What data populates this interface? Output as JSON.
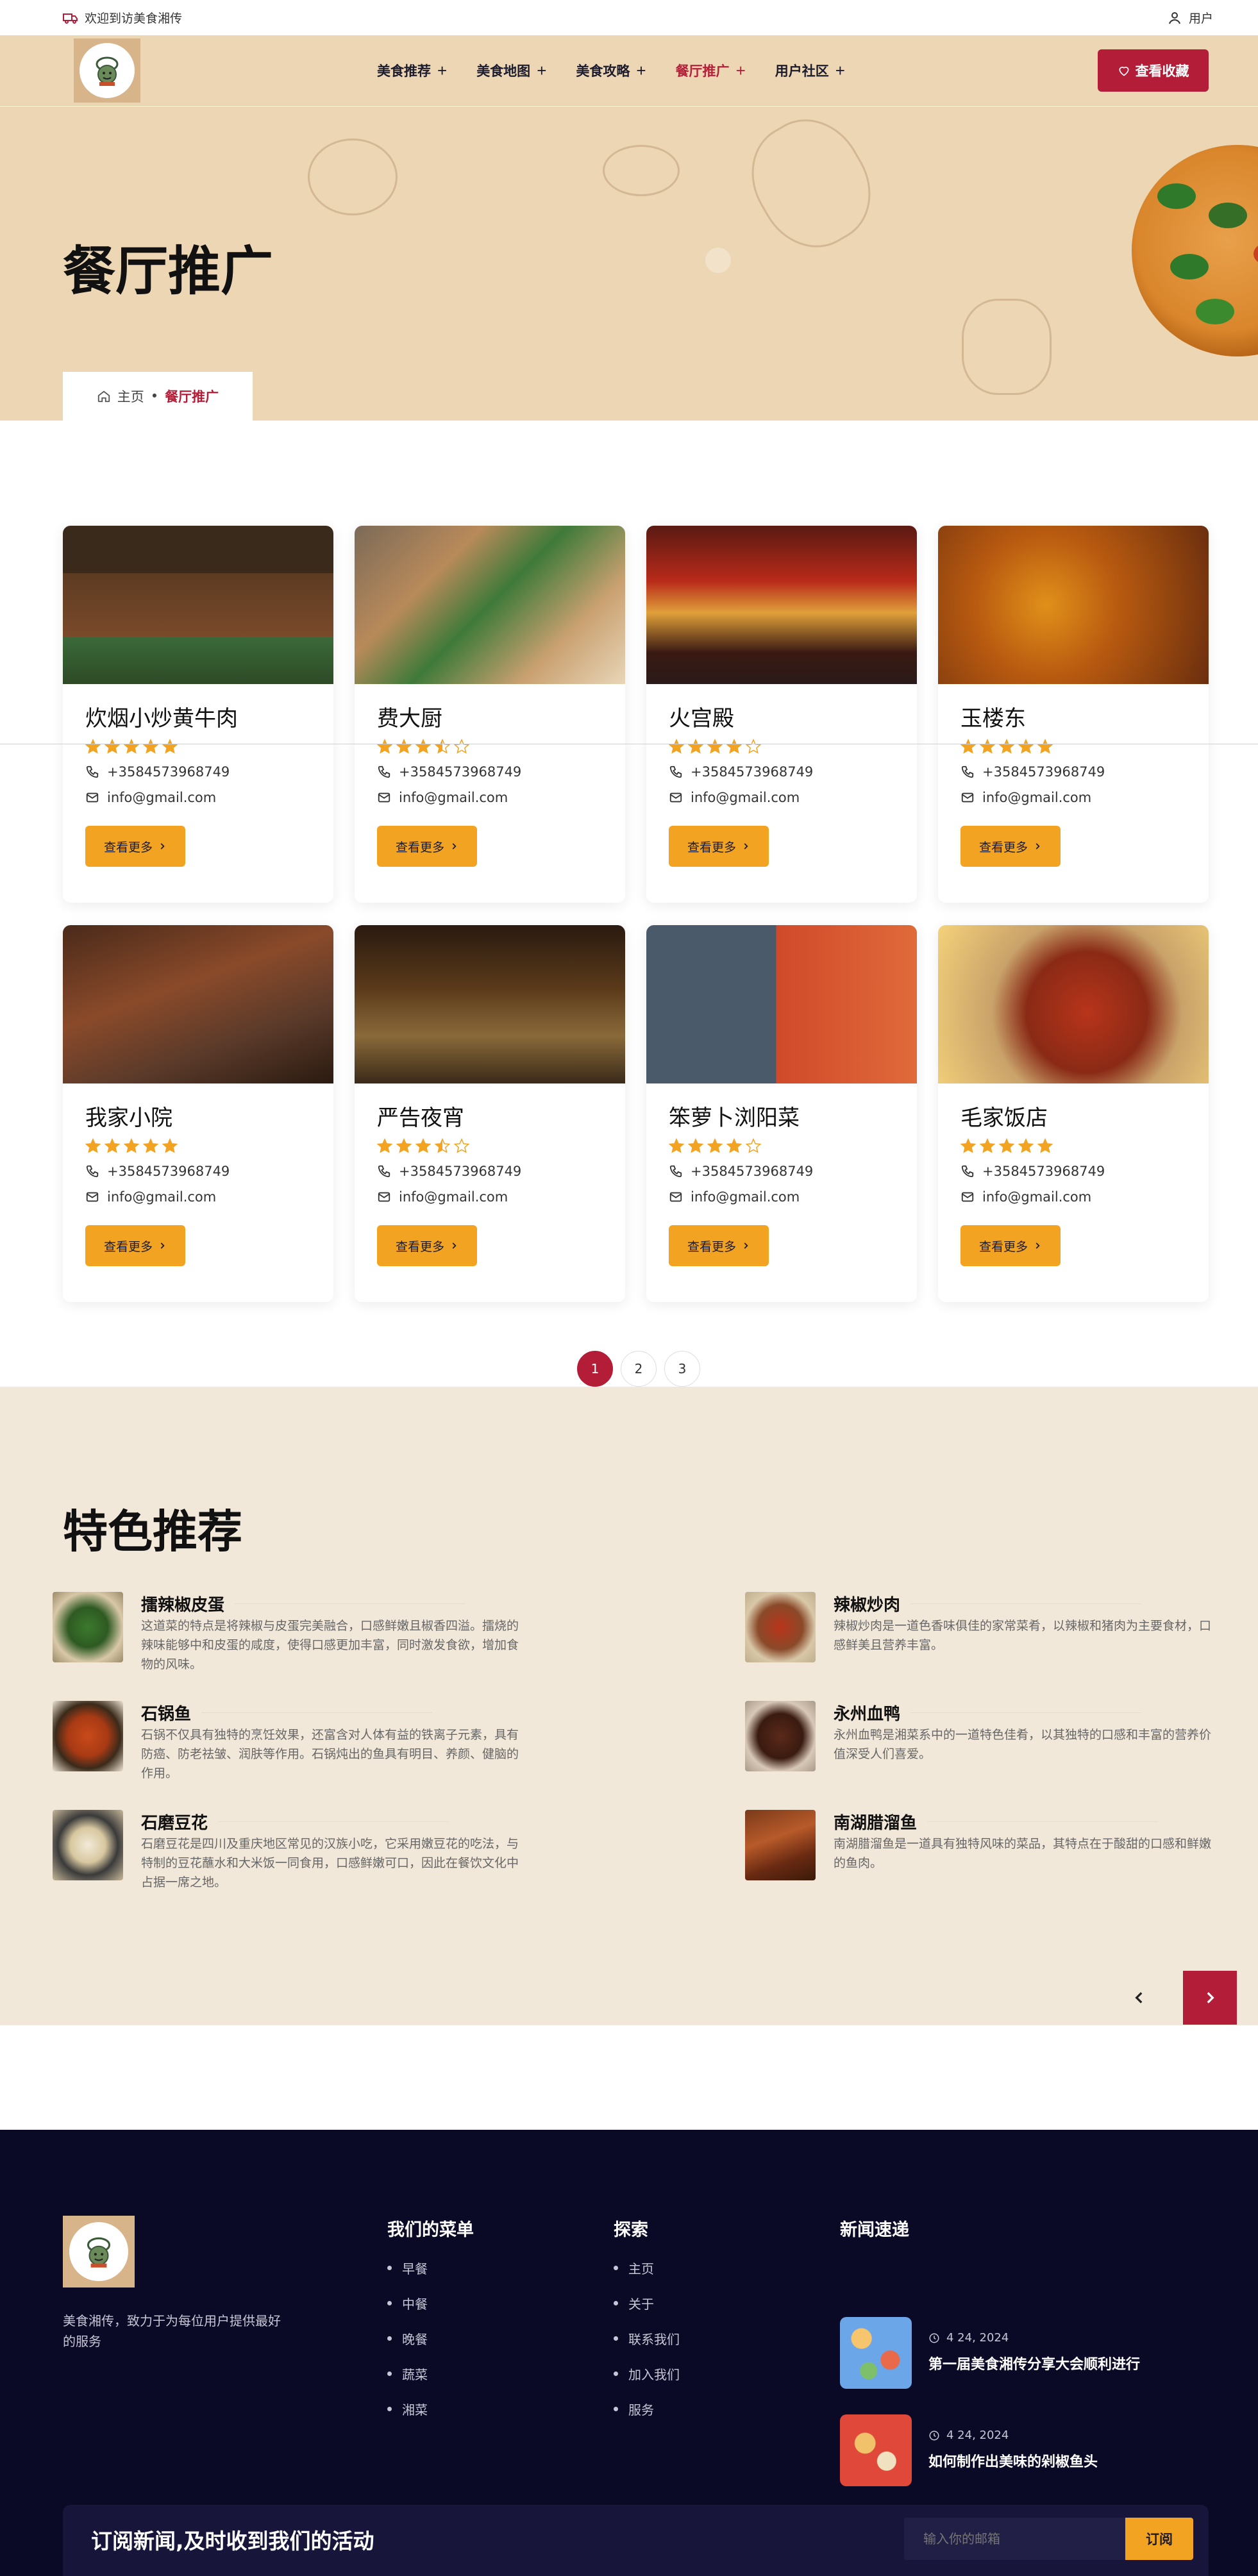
{
  "topbar": {
    "welcome": "欢迎到访美食湘传",
    "user": "用户"
  },
  "nav": {
    "items": [
      {
        "label": "美食推荐"
      },
      {
        "label": "美食地图"
      },
      {
        "label": "美食攻略"
      },
      {
        "label": "餐厅推广",
        "active": true
      },
      {
        "label": "用户社区"
      }
    ],
    "fav_label": "查看收藏"
  },
  "hero": {
    "title": "餐厅推广",
    "breadcrumb_home": "主页",
    "breadcrumb_sep": "•",
    "breadcrumb_current": "餐厅推广"
  },
  "restaurants": [
    {
      "name": "炊烟小炒黄牛肉",
      "rating": 5,
      "phone": "+3584573968749",
      "email": "info@gmail.com",
      "button": "查看更多"
    },
    {
      "name": "费大厨",
      "rating": 3.5,
      "phone": "+3584573968749",
      "email": "info@gmail.com",
      "button": "查看更多"
    },
    {
      "name": "火宫殿",
      "rating": 4,
      "phone": "+3584573968749",
      "email": "info@gmail.com",
      "button": "查看更多"
    },
    {
      "name": "玉楼东",
      "rating": 5,
      "phone": "+3584573968749",
      "email": "info@gmail.com",
      "button": "查看更多"
    },
    {
      "name": "我家小院",
      "rating": 5,
      "phone": "+3584573968749",
      "email": "info@gmail.com",
      "button": "查看更多"
    },
    {
      "name": "严告夜宵",
      "rating": 3.5,
      "phone": "+3584573968749",
      "email": "info@gmail.com",
      "button": "查看更多"
    },
    {
      "name": "笨萝卜浏阳菜",
      "rating": 4,
      "phone": "+3584573968749",
      "email": "info@gmail.com",
      "button": "查看更多"
    },
    {
      "name": "毛家饭店",
      "rating": 5,
      "phone": "+3584573968749",
      "email": "info@gmail.com",
      "button": "查看更多"
    }
  ],
  "pagination": {
    "pages": [
      "1",
      "2",
      "3"
    ],
    "current": "1"
  },
  "specials": {
    "title": "特色推荐",
    "dishes": [
      {
        "name": "擂辣椒皮蛋",
        "desc": "这道菜的特点是将辣椒与皮蛋完美融合，口感鲜嫩且椒香四溢。擂烧的辣味能够中和皮蛋的咸度，使得口感更加丰富，同时激发食欲，增加食物的风味。"
      },
      {
        "name": "辣椒炒肉",
        "desc": "辣椒炒肉是一道色香味俱佳的家常菜肴，以辣椒和猪肉为主要食材，口感鲜美且营养丰富。"
      },
      {
        "name": "石锅鱼",
        "desc": "石锅不仅具有独特的烹饪效果，还富含对人体有益的铁离子元素，具有防癌、防老祛皱、润肤等作用。石锅炖出的鱼具有明目、养颜、健脑的作用。"
      },
      {
        "name": "永州血鸭",
        "desc": "永州血鸭是湘菜系中的一道特色佳肴，以其独特的口感和丰富的营养价值深受人们喜爱。"
      },
      {
        "name": "石磨豆花",
        "desc": "石磨豆花是四川及重庆地区常见的汉族小吃，它采用嫩豆花的吃法，与特制的豆花蘸水和大米饭一同食用，口感鲜嫩可口，因此在餐饮文化中占据一席之地。"
      },
      {
        "name": "南湖腊溜鱼",
        "desc": "南湖腊溜鱼是一道具有独特风味的菜品，其特点在于酸甜的口感和鲜嫩的鱼肉。"
      }
    ]
  },
  "footer": {
    "tagline": "美食湘传，致力于为每位用户提供最好的服务",
    "menu_title": "我们的菜单",
    "menu_items": [
      "早餐",
      "中餐",
      "晚餐",
      "蔬菜",
      "湘菜"
    ],
    "explore_title": "探索",
    "explore_items": [
      "主页",
      "关于",
      "联系我们",
      "加入我们",
      "服务"
    ],
    "news_title": "新闻速递",
    "news": [
      {
        "date": "4 24, 2024",
        "title": "第一届美食湘传分享大会顺利进行"
      },
      {
        "date": "4 24, 2024",
        "title": "如何制作出美味的剁椒鱼头"
      }
    ],
    "subscribe_title": "订阅新闻,及时收到我们的活动",
    "subscribe_placeholder": "输入你的邮箱",
    "subscribe_button": "订阅"
  },
  "colors": {
    "accent_red": "#b31d38",
    "accent_orange": "#f2a321",
    "hero_bg": "#ecd6b4",
    "footer_bg": "#0b0a26",
    "specials_bg": "#f2e8d9"
  }
}
